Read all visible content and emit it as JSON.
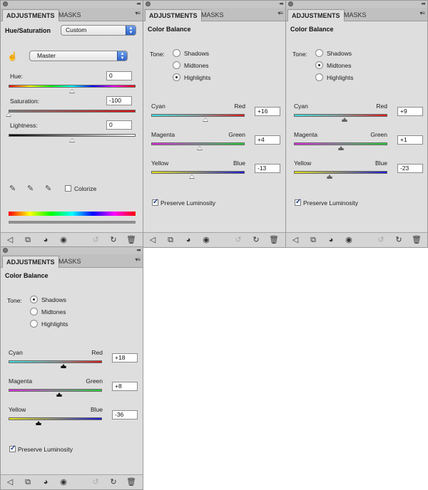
{
  "tabs": {
    "adjustments": "ADJUSTMENTS",
    "masks": "MASKS"
  },
  "hue_saturation": {
    "title": "Hue/Saturation",
    "preset": "Custom",
    "channel": "Master",
    "hue_label": "Hue:",
    "hue_value": "0",
    "saturation_label": "Saturation:",
    "saturation_value": "-100",
    "lightness_label": "Lightness:",
    "lightness_value": "0",
    "colorize_label": "Colorize"
  },
  "color_balance_panels": [
    {
      "title": "Color Balance",
      "tone_label": "Tone:",
      "tones": [
        "Shadows",
        "Midtones",
        "Highlights"
      ],
      "selected_tone": "Highlights",
      "rows": [
        {
          "left": "Cyan",
          "right": "Red",
          "value": "+16",
          "amount": 16
        },
        {
          "left": "Magenta",
          "right": "Green",
          "value": "+4",
          "amount": 4
        },
        {
          "left": "Yellow",
          "right": "Blue",
          "value": "-13",
          "amount": -13
        }
      ],
      "preserve_label": "Preserve Luminosity",
      "preserve_checked": true
    },
    {
      "title": "Color Balance",
      "tone_label": "Tone:",
      "tones": [
        "Shadows",
        "Midtones",
        "Highlights"
      ],
      "selected_tone": "Midtones",
      "rows": [
        {
          "left": "Cyan",
          "right": "Red",
          "value": "+9",
          "amount": 9
        },
        {
          "left": "Magenta",
          "right": "Green",
          "value": "+1",
          "amount": 1
        },
        {
          "left": "Yellow",
          "right": "Blue",
          "value": "-23",
          "amount": -23
        }
      ],
      "preserve_label": "Preserve Luminosity",
      "preserve_checked": true
    },
    {
      "title": "Color Balance",
      "tone_label": "Tone:",
      "tones": [
        "Shadows",
        "Midtones",
        "Highlights"
      ],
      "selected_tone": "Shadows",
      "rows": [
        {
          "left": "Cyan",
          "right": "Red",
          "value": "+18",
          "amount": 18
        },
        {
          "left": "Magenta",
          "right": "Green",
          "value": "+8",
          "amount": 8
        },
        {
          "left": "Yellow",
          "right": "Blue",
          "value": "-36",
          "amount": -36
        }
      ],
      "preserve_label": "Preserve Luminosity",
      "preserve_checked": true
    }
  ],
  "footer_icons": [
    "back-arrow-icon",
    "clip-to-layer-icon",
    "layer-visibility-icon",
    "eye-icon",
    "view-previous-state-icon",
    "reset-icon",
    "trash-icon"
  ],
  "colors": {
    "cyan_red": [
      "#3ee0e0",
      "#e01b1b"
    ],
    "magenta_green": [
      "#e02ae0",
      "#28d23a"
    ],
    "yellow_blue": [
      "#e6e61a",
      "#1b1bd8"
    ]
  }
}
